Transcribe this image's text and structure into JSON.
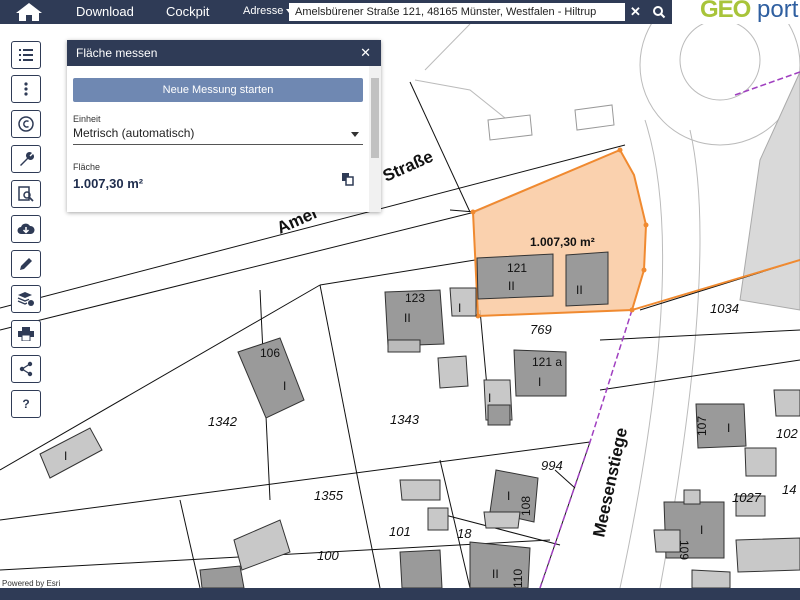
{
  "topbar": {
    "nav": [
      "Download",
      "Cockpit"
    ],
    "address_dropdown": "Adresse",
    "search_value": "Amelsbürener Straße 121, 48165 Münster, Westfalen - Hiltrup",
    "logo_geo": "GEO",
    "logo_rest": "port"
  },
  "toolbar": [
    "list-icon",
    "more-vertical-icon",
    "copyright-icon",
    "wrench-icon",
    "document-search-icon",
    "cloud-download-icon",
    "pencil-icon",
    "layers-add-icon",
    "print-icon",
    "share-icon",
    "help-icon"
  ],
  "toolbar_help_label": "?",
  "panel": {
    "title": "Fläche messen",
    "start_button": "Neue Messung starten",
    "unit_label": "Einheit",
    "unit_value": "Metrisch (automatisch)",
    "area_label": "Fläche",
    "area_value": "1.007,30 m²"
  },
  "map": {
    "measurement_label": "1.007,30 m²",
    "streets": [
      "Amel",
      "Straße",
      "Meesenstiege"
    ],
    "parcels": [
      "769",
      "1034",
      "1342",
      "1343",
      "1355",
      "994",
      "1027",
      "101",
      "100",
      "18",
      "102",
      "14"
    ],
    "buildings": [
      {
        "number": "121",
        "floors": "II"
      },
      {
        "number": "",
        "floors": "II"
      },
      {
        "number": "123",
        "floors": "II"
      },
      {
        "number": "121 a",
        "floors": "I"
      },
      {
        "number": "106",
        "floors": "I"
      },
      {
        "number": "107",
        "floors": "I"
      },
      {
        "number": "108",
        "floors": "I"
      },
      {
        "number": "109",
        "floors": "I"
      },
      {
        "number": "110",
        "floors": "II"
      }
    ],
    "small_building_floors": "I"
  },
  "attribution": "Powered by Esri",
  "colors": {
    "header": "#2f3b56",
    "button": "#6f88b2",
    "measure_fill": "#f9c9a0",
    "measure_stroke": "#f08a30",
    "building": "#9a9a9a",
    "logo_green": "#a8c43a"
  }
}
